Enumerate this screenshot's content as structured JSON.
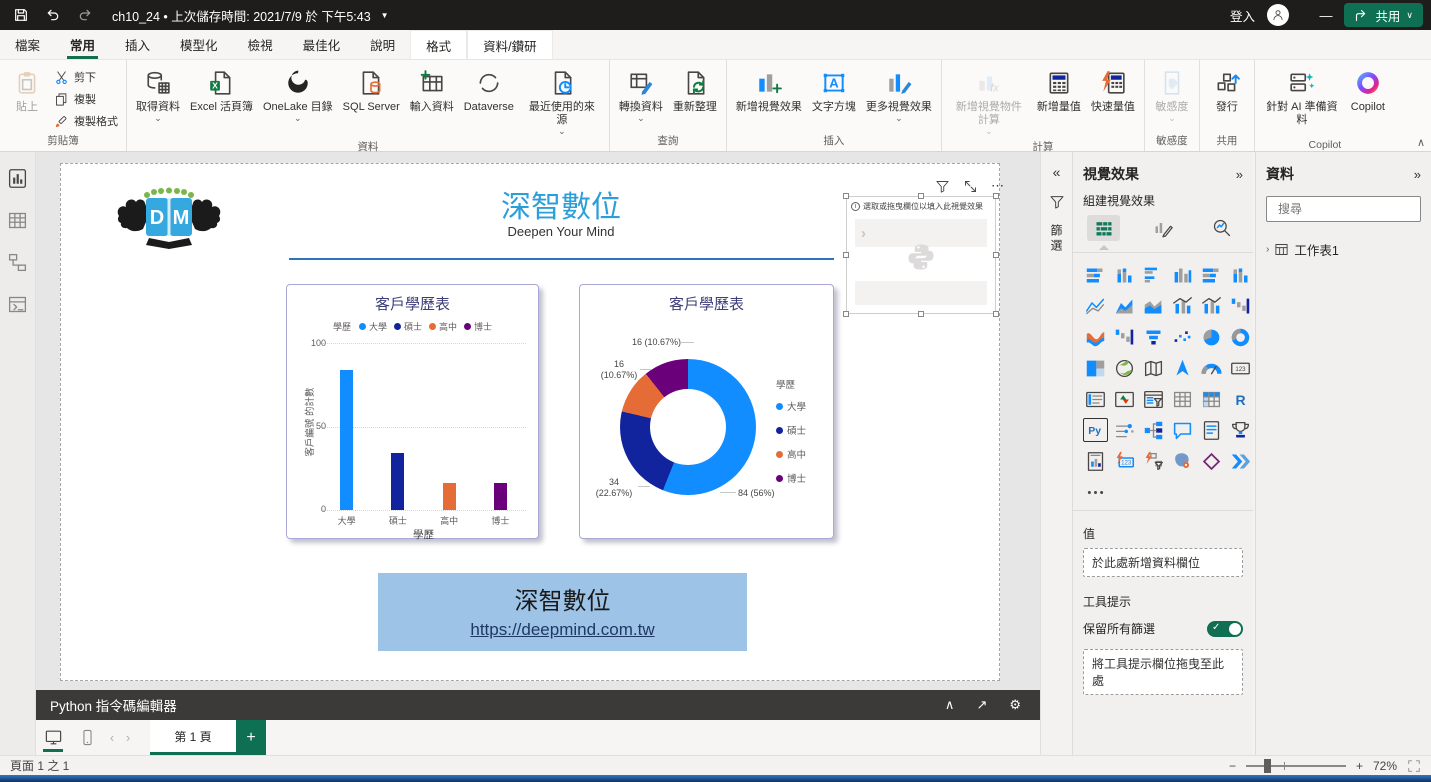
{
  "glyphs": {
    "caret_down": "⌄",
    "dropdown": "▼",
    "chevrons_left": "«",
    "chevrons_right": "»",
    "more_h": "⋯",
    "ellipsis": "…",
    "run": "▶",
    "open_new": "↗",
    "gear": "⚙",
    "collapse_up": "∧",
    "minus": "−",
    "plus": "+",
    "page_back": "‹",
    "page_fwd": "›",
    "window_min": "—",
    "window_close": "×",
    "share_caret": "∨",
    "chev_right": "›",
    "info": "i",
    "gt": "›"
  },
  "titlebar": {
    "title": "ch10_24 • 上次儲存時間: 2021/7/9 於 下午5:43",
    "sign_in": "登入"
  },
  "menu_tabs": {
    "share": "共用",
    "items": [
      {
        "name": "tab-file",
        "label": "檔案"
      },
      {
        "name": "tab-home",
        "label": "常用",
        "active": true
      },
      {
        "name": "tab-insert",
        "label": "插入"
      },
      {
        "name": "tab-modeling",
        "label": "模型化"
      },
      {
        "name": "tab-view",
        "label": "檢視"
      },
      {
        "name": "tab-optimize",
        "label": "最佳化"
      },
      {
        "name": "tab-help",
        "label": "說明"
      },
      {
        "name": "tab-format",
        "label": "格式",
        "contextual": true
      },
      {
        "name": "tab-data-drill",
        "label": "資料/鑽研",
        "contextual": true
      }
    ]
  },
  "ribbon": {
    "clipboard_label": "剪貼簿",
    "paste": "貼上",
    "cut": "剪下",
    "copy": "複製",
    "format_painter": "複製格式",
    "data_label": "資料",
    "data_items": [
      {
        "name": "get-data-button",
        "label": "取得資料",
        "icon": "getdata",
        "caret": "⌄"
      },
      {
        "name": "excel-workbook-button",
        "label": "Excel 活頁簿",
        "icon": "excel"
      },
      {
        "name": "onelake-catalog-button",
        "label": "OneLake 目錄",
        "icon": "onelake",
        "caret": "⌄"
      },
      {
        "name": "sql-server-button",
        "label": "SQL Server",
        "icon": "sql"
      },
      {
        "name": "enter-data-button",
        "label": "輸入資料",
        "icon": "enterdata"
      },
      {
        "name": "dataverse-button",
        "label": "Dataverse",
        "icon": "dataverse"
      },
      {
        "name": "recent-sources-button",
        "label": "最近使用的來源",
        "icon": "recent",
        "caret": "⌄"
      }
    ],
    "query_label": "查詢",
    "query_items": [
      {
        "name": "transform-data-button",
        "label": "轉換資料",
        "icon": "transform",
        "caret": "⌄"
      },
      {
        "name": "refresh-button",
        "label": "重新整理",
        "icon": "refresh"
      }
    ],
    "insert_label": "插入",
    "insert_items": [
      {
        "name": "new-visual-button",
        "label": "新增視覺效果",
        "icon": "newvisual"
      },
      {
        "name": "text-box-button",
        "label": "文字方塊",
        "icon": "textbox"
      },
      {
        "name": "more-visuals-button",
        "label": "更多視覺效果",
        "icon": "morevisuals",
        "caret": "⌄"
      }
    ],
    "calc_label": "計算",
    "calc_items": [
      {
        "name": "new-visual-calculation-button",
        "label": "新增視覺物件計算",
        "icon": "visualcalc",
        "caret": "⌄",
        "disabled": true
      },
      {
        "name": "new-measure-button",
        "label": "新增量值",
        "icon": "newmeasure"
      },
      {
        "name": "quick-measure-button",
        "label": "快速量值",
        "icon": "quickmeasure"
      }
    ],
    "sensitivity_label": "敏感度",
    "sensitivity_items": [
      {
        "name": "sensitivity-button",
        "label": "敏感度",
        "icon": "sensitivity",
        "caret": "⌄",
        "disabled": true
      }
    ],
    "share_label": "共用",
    "share_items": [
      {
        "name": "publish-button",
        "label": "發行",
        "icon": "publish"
      }
    ],
    "copilot_label": "Copilot",
    "copilot_items": [
      {
        "name": "prep-data-for-ai-button",
        "label": "針對 AI 準備資料",
        "icon": "aiprep"
      },
      {
        "name": "copilot-button",
        "label": "Copilot",
        "icon": "copilot"
      }
    ]
  },
  "report": {
    "title": "深智數位",
    "subtitle": "Deepen Your Mind",
    "banner": {
      "title": "深智數位",
      "url": "https://deepmind.com.tw"
    }
  },
  "python_visual": {
    "hint": "選取或拖曳欄位以填入此視覺效果"
  },
  "charts": {
    "bar": {
      "title": "客戶學歷表",
      "legend_title": "學歷",
      "y_ticks": [
        "100",
        "50",
        "0"
      ],
      "y_label": "客戶編號 的計數",
      "x_label": "學歷"
    },
    "donut": {
      "title": "客戶學歷表",
      "legend_title": "學歷",
      "callout_top": "16 (10.67%)",
      "callout_left_1": "16",
      "callout_left_2": "(10.67%)",
      "callout_bl_1": "34",
      "callout_bl_2": "(22.67%)",
      "callout_br": "84 (56%)"
    },
    "legend_items": [
      {
        "label": "大學",
        "color": "#118DFF"
      },
      {
        "label": "碩士",
        "color": "#12239E"
      },
      {
        "label": "高中",
        "color": "#E66C37"
      },
      {
        "label": "博士",
        "color": "#6B007B"
      }
    ]
  },
  "chart_data": [
    {
      "type": "bar",
      "title": "客戶學歷表",
      "categories": [
        "大學",
        "碩士",
        "高中",
        "博士"
      ],
      "values": [
        84,
        34,
        16,
        16
      ],
      "colors": [
        "#118DFF",
        "#12239E",
        "#E66C37",
        "#6B007B"
      ],
      "xlabel": "學歷",
      "ylabel": "客戶編號 的計數",
      "ylim": [
        0,
        100
      ],
      "legend": "學歷",
      "legend_position": "top"
    },
    {
      "type": "donut",
      "title": "客戶學歷表",
      "categories": [
        "大學",
        "碩士",
        "高中",
        "博士"
      ],
      "values": [
        84,
        34,
        16,
        16
      ],
      "percents": [
        "56%",
        "22.67%",
        "10.67%",
        "10.67%"
      ],
      "data_labels": [
        "84 (56%)",
        "34 (22.67%)",
        "16 (10.67%)",
        "16 (10.67%)"
      ],
      "colors": [
        "#118DFF",
        "#12239E",
        "#E66C37",
        "#6B007B"
      ],
      "legend": "學歷",
      "legend_position": "right"
    }
  ],
  "python_editor": {
    "title": "Python 指令碼編輯器"
  },
  "pages": {
    "tab": "第 1 頁",
    "add": "+"
  },
  "status": {
    "page_info": "頁面 1 之 1",
    "zoom": "72%"
  },
  "panels": {
    "filters": {
      "label": "篩選"
    },
    "visualizations": {
      "title": "視覺效果",
      "build_label": "組建視覺效果",
      "values_label": "值",
      "values_well": "於此處新增資料欄位",
      "tooltips_label": "工具提示",
      "keep_filters_label": "保留所有篩選",
      "tooltip_well": "將工具提示欄位拖曳至此處",
      "gallery": [
        {
          "n": "stacked-bar-chart",
          "k": "g_barh"
        },
        {
          "n": "stacked-column-chart",
          "k": "g_barv"
        },
        {
          "n": "clustered-bar-chart",
          "k": "g_barh2"
        },
        {
          "n": "clustered-column-chart",
          "k": "g_barv2"
        },
        {
          "n": "100-stacked-bar-chart",
          "k": "g_barh"
        },
        {
          "n": "100-stacked-column-chart",
          "k": "g_barv"
        },
        {
          "n": "line-chart",
          "k": "g_line"
        },
        {
          "n": "area-chart",
          "k": "g_area"
        },
        {
          "n": "stacked-area-chart",
          "k": "g_area2"
        },
        {
          "n": "line-and-stacked-column-chart",
          "k": "g_combo"
        },
        {
          "n": "line-and-clustered-column-chart",
          "k": "g_combo"
        },
        {
          "n": "waterfall-chart",
          "k": "g_fall"
        },
        {
          "n": "ribbon-chart",
          "k": "g_wave"
        },
        {
          "n": "waterfall-chart-2",
          "k": "g_fall"
        },
        {
          "n": "funnel-chart",
          "k": "g_funnel"
        },
        {
          "n": "scatter-chart",
          "k": "g_scatter"
        },
        {
          "n": "pie-chart",
          "k": "g_pie"
        },
        {
          "n": "donut-chart",
          "k": "g_donut"
        },
        {
          "n": "treemap",
          "k": "g_tree"
        },
        {
          "n": "map",
          "k": "g_globe"
        },
        {
          "n": "filled-map",
          "k": "g_map"
        },
        {
          "n": "azure-map",
          "k": "g_arrow"
        },
        {
          "n": "gauge",
          "k": "g_gauge"
        },
        {
          "n": "card",
          "k": "g_card"
        },
        {
          "n": "multi-row-card",
          "k": "g_mcard"
        },
        {
          "n": "kpi",
          "k": "g_kpi"
        },
        {
          "n": "slicer",
          "k": "g_slicer"
        },
        {
          "n": "table",
          "k": "g_table"
        },
        {
          "n": "matrix",
          "k": "g_matrix"
        },
        {
          "n": "r-script-visual",
          "k": "g_R"
        },
        {
          "n": "python-visual",
          "k": "g_Py",
          "selected": true
        },
        {
          "n": "key-influencers",
          "k": "g_keyinf"
        },
        {
          "n": "decomposition-tree",
          "k": "g_dtree"
        },
        {
          "n": "qna-visual",
          "k": "g_qna"
        },
        {
          "n": "smart-narrative",
          "k": "g_doc"
        },
        {
          "n": "metrics",
          "k": "g_trophy"
        },
        {
          "n": "paginated-report",
          "k": "g_report"
        },
        {
          "n": "quick-calc-visual",
          "k": "g_bolt123"
        },
        {
          "n": "ai-slicer-visual",
          "k": "g_boltai"
        },
        {
          "n": "arcgis-map",
          "k": "g_arcgis"
        },
        {
          "n": "power-apps-visual",
          "k": "g_papps"
        },
        {
          "n": "power-automate-visual",
          "k": "g_pauto"
        },
        {
          "n": "more-visual-options",
          "k": "g_dots"
        }
      ]
    },
    "data": {
      "title": "資料",
      "search_placeholder": "搜尋",
      "table_name": "工作表1"
    }
  }
}
